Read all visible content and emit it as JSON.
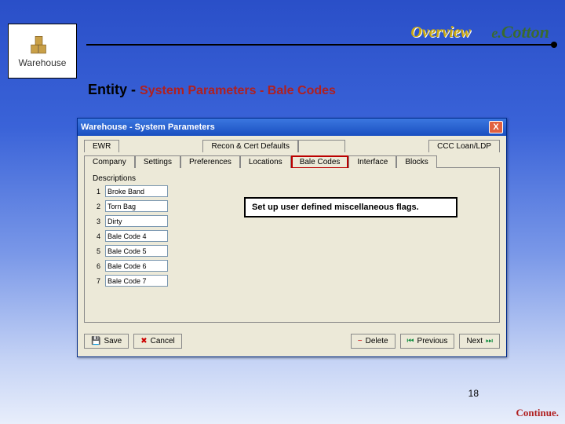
{
  "header": {
    "left_logo_label": "Warehouse",
    "overview": "Overview",
    "brand": "e.Cotton"
  },
  "title": {
    "entity": "Entity",
    "dash": " - ",
    "sub": "System Parameters - Bale Codes"
  },
  "dialog": {
    "title": "Warehouse - System Parameters",
    "close": "X",
    "tab_row1": [
      "EWR",
      "Recon & Cert Defaults",
      "",
      "CCC Loan/LDP"
    ],
    "tab_row2": [
      "Company",
      "Settings",
      "Preferences",
      "Locations",
      "Bale Codes",
      "Interface",
      "Blocks"
    ],
    "active_tab_index": 4,
    "desc_label": "Descriptions",
    "rows": [
      {
        "n": "1",
        "v": "Broke Band"
      },
      {
        "n": "2",
        "v": "Torn Bag"
      },
      {
        "n": "3",
        "v": "Dirty"
      },
      {
        "n": "4",
        "v": "Bale Code 4"
      },
      {
        "n": "5",
        "v": "Bale Code 5"
      },
      {
        "n": "6",
        "v": "Bale Code 6"
      },
      {
        "n": "7",
        "v": "Bale Code 7"
      }
    ],
    "buttons": {
      "save": "Save",
      "cancel": "Cancel",
      "delete": "Delete",
      "prev": "Previous",
      "next": "Next"
    }
  },
  "callout": "Set up user defined miscellaneous flags.",
  "page_number": "18",
  "continue": "Continue."
}
